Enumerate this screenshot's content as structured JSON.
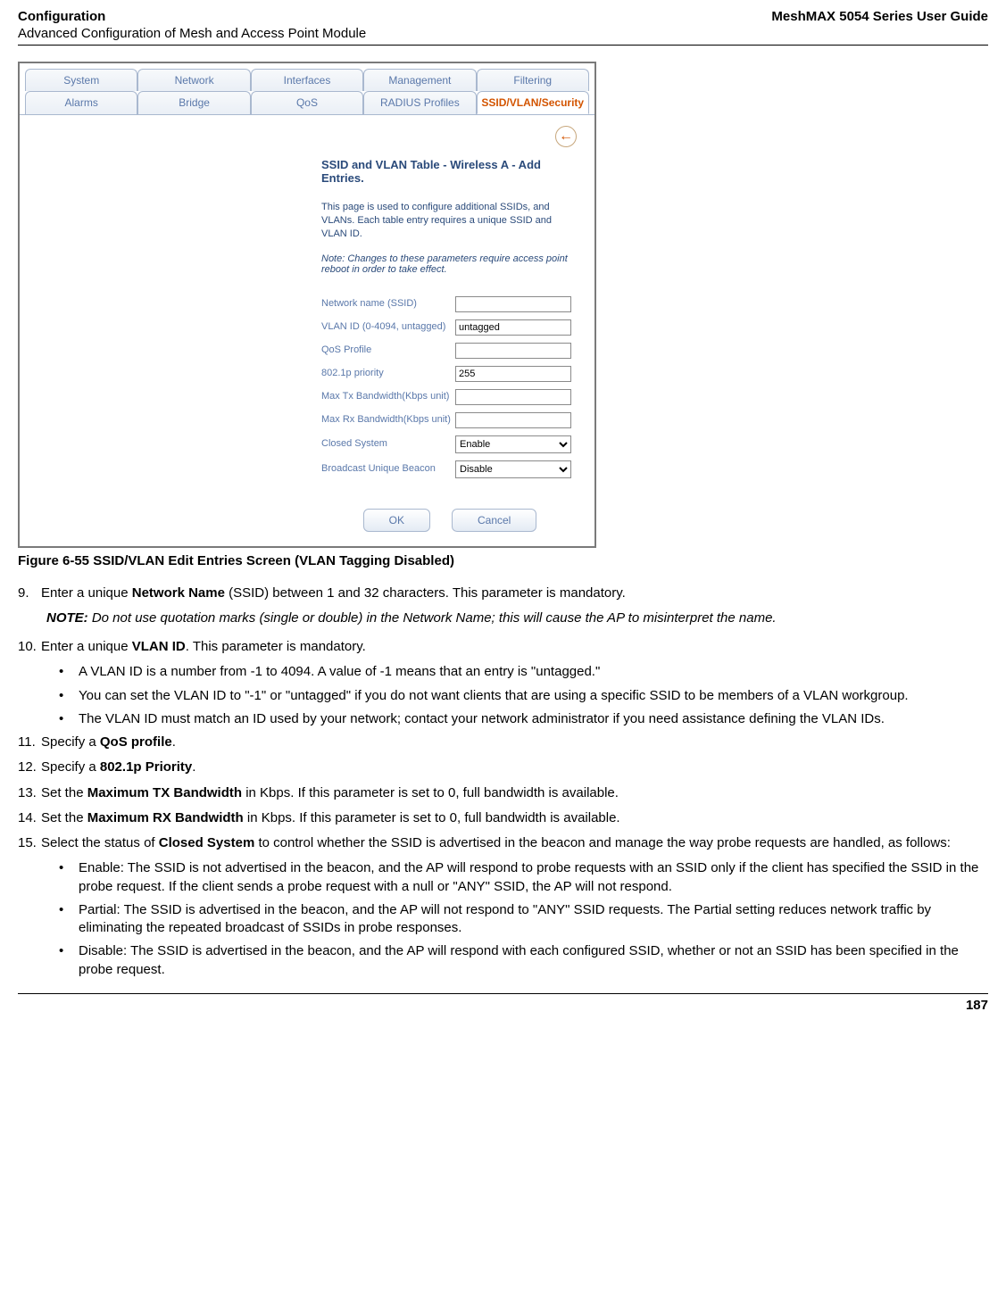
{
  "header": {
    "left_bold": "Configuration",
    "left_sub": "Advanced Configuration of Mesh and Access Point Module",
    "right": "MeshMAX 5054 Series User Guide"
  },
  "app": {
    "tabs1": [
      "System",
      "Network",
      "Interfaces",
      "Management",
      "Filtering"
    ],
    "tabs2": [
      "Alarms",
      "Bridge",
      "QoS",
      "RADIUS Profiles",
      "SSID/VLAN/Security"
    ],
    "active_tab2_index": 4,
    "back_icon": "←",
    "form_title": "SSID and VLAN Table - Wireless A - Add Entries.",
    "form_help": "This page is used to configure additional SSIDs, and VLANs. Each table entry requires a unique SSID and VLAN ID.",
    "form_note": "Note: Changes to these parameters require access point reboot in order to take effect.",
    "fields": {
      "network_name": {
        "label": "Network name (SSID)",
        "value": ""
      },
      "vlan_id": {
        "label": "VLAN ID (0-4094, untagged)",
        "value": "untagged"
      },
      "qos_profile": {
        "label": "QoS Profile",
        "value": ""
      },
      "priority": {
        "label": "802.1p priority",
        "value": "255"
      },
      "max_tx": {
        "label": "Max Tx Bandwidth(Kbps unit)",
        "value": ""
      },
      "max_rx": {
        "label": "Max Rx Bandwidth(Kbps unit)",
        "value": ""
      },
      "closed_system": {
        "label": "Closed System",
        "value": "Enable"
      },
      "broadcast_beacon": {
        "label": "Broadcast Unique Beacon",
        "value": "Disable"
      }
    },
    "buttons": {
      "ok": "OK",
      "cancel": "Cancel"
    }
  },
  "fig_caption": "Figure 6-55 SSID/VLAN Edit Entries Screen (VLAN Tagging Disabled)",
  "steps": {
    "s9_num": "9.",
    "s9_a": "Enter a unique ",
    "s9_bold": "Network Name",
    "s9_b": " (SSID) between 1 and 32 characters. This parameter is mandatory.",
    "note_label": "NOTE:",
    "note_text": " Do not use quotation marks (single or double) in the Network Name; this will cause the AP to misinterpret the name.",
    "s10_num": "10.",
    "s10_a": "Enter a unique ",
    "s10_bold": "VLAN ID",
    "s10_b": ". This parameter is mandatory.",
    "s10_bullets": [
      "A VLAN ID is a number from -1 to 4094. A value of -1 means that an entry is \"untagged.\"",
      "You can set the VLAN ID to \"-1\" or \"untagged\" if you do not want clients that are using a specific SSID to be members of a VLAN workgroup.",
      "The VLAN ID must match an ID used by your network; contact your network administrator if you need assistance defining the VLAN IDs."
    ],
    "s11_num": "11.",
    "s11_a": "Specify a ",
    "s11_bold": "QoS profile",
    "s11_b": ".",
    "s12_num": "12.",
    "s12_a": "Specify a ",
    "s12_bold": "802.1p Priority",
    "s12_b": ".",
    "s13_num": "13.",
    "s13_a": "Set the ",
    "s13_bold": "Maximum TX Bandwidth",
    "s13_b": " in Kbps. If this parameter is set to 0, full bandwidth is available.",
    "s14_num": "14.",
    "s14_a": "Set the ",
    "s14_bold": "Maximum RX Bandwidth",
    "s14_b": " in Kbps. If this parameter is set to 0, full bandwidth is available.",
    "s15_num": "15.",
    "s15_a": "Select the status of ",
    "s15_bold": "Closed System",
    "s15_b": " to control whether the SSID is advertised in the beacon and manage the way probe requests are handled, as follows:",
    "s15_bullets": [
      {
        "bold": "Enable:",
        "text": " The SSID is not advertised in the beacon, and the AP will respond to probe requests with an SSID only if the client has specified the SSID in the probe request. If the client sends a probe request with a null or \"ANY\" SSID, the AP will not respond."
      },
      {
        "bold": "Partial:",
        "text": " The SSID is advertised in the beacon, and the AP will not respond to \"ANY\" SSID requests. The Partial setting reduces network traffic by eliminating the repeated broadcast of SSIDs in probe responses."
      },
      {
        "bold": "Disable:",
        "text": " The SSID is advertised in the beacon, and the AP will respond with each configured SSID, whether or not an SSID has been specified in the probe request."
      }
    ]
  },
  "page_num": "187"
}
